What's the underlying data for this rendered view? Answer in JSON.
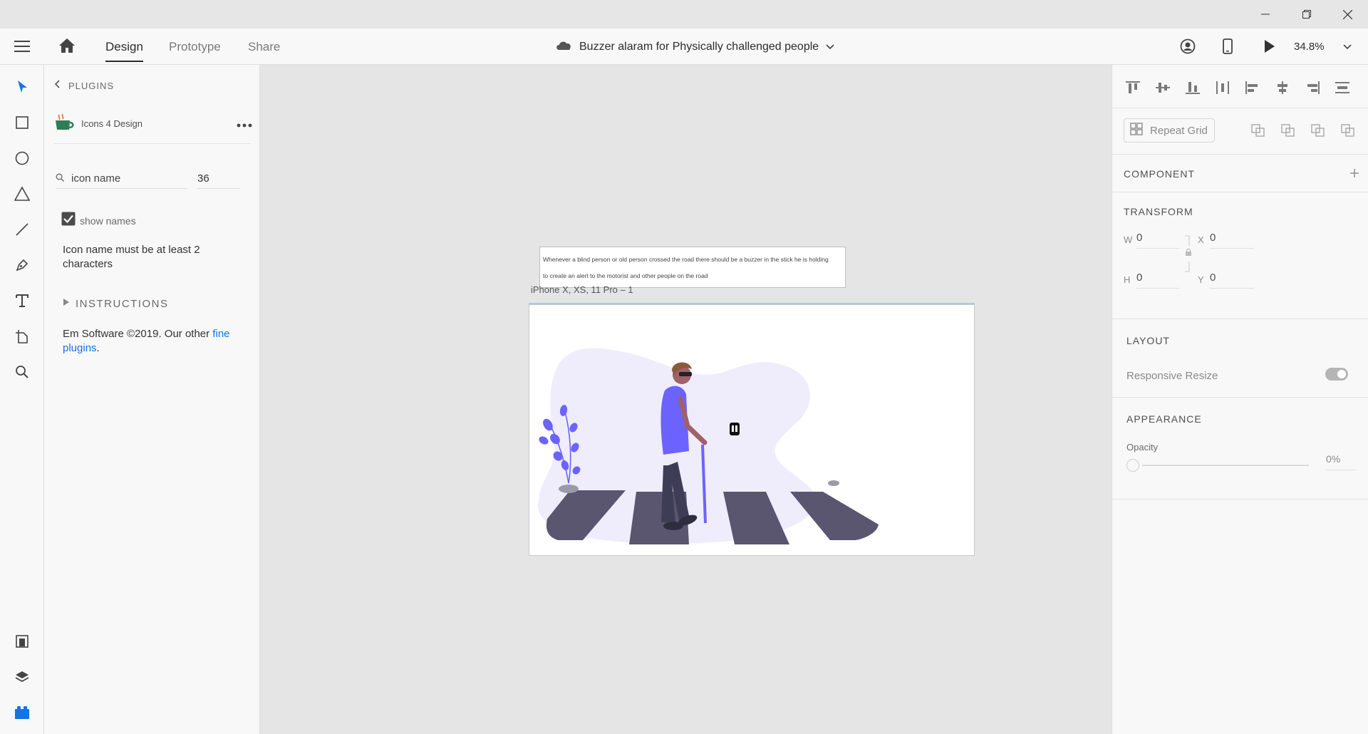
{
  "window": {
    "controls": [
      "minimize-icon",
      "restore-icon",
      "close-icon"
    ]
  },
  "toolbar": {
    "tabs": [
      {
        "label": "Design",
        "active": true
      },
      {
        "label": "Prototype",
        "active": false
      },
      {
        "label": "Share",
        "active": false
      }
    ],
    "document_title": "Buzzer alaram for Physically challenged people",
    "zoom": "34.8%"
  },
  "left_rail": {
    "tools": [
      "select-icon",
      "rectangle-icon",
      "ellipse-icon",
      "polygon-icon",
      "line-icon",
      "pen-icon",
      "text-icon",
      "artboard-icon",
      "zoom-icon"
    ],
    "bottom": [
      "assets-icon",
      "layers-icon",
      "plugins-icon"
    ]
  },
  "plugins": {
    "back_label": "PLUGINS",
    "plugin_name": "Icons 4 Design",
    "search_placeholder": "icon name",
    "size_value": "36",
    "show_names_label": "show names",
    "show_names_checked": true,
    "message": "Icon name must be at least 2 characters",
    "instructions_label": "INSTRUCTIONS",
    "footer_text": "Em Software ©2019. Our other ",
    "footer_link": "fine plugins",
    "footer_end": "."
  },
  "canvas": {
    "note_line1": "Whenever a blind person or old person crossed the road there should be a buzzer in the stick he is holding",
    "note_line2": "to create an alert to the motorist and other people on the road",
    "artboard_label": "iPhone X, XS, 11 Pro – 1"
  },
  "right_panel": {
    "repeat_grid_label": "Repeat Grid",
    "component_title": "COMPONENT",
    "transform_title": "TRANSFORM",
    "w_label": "W",
    "w_value": "0",
    "h_label": "H",
    "h_value": "0",
    "x_label": "X",
    "x_value": "0",
    "y_label": "Y",
    "y_value": "0",
    "layout_title": "LAYOUT",
    "responsive_label": "Responsive Resize",
    "appearance_title": "APPEARANCE",
    "opacity_label": "Opacity",
    "opacity_value": "0%"
  },
  "colors": {
    "accent": "#1473e6",
    "illustration_purple": "#6c63ff",
    "crosswalk": "#5a5670",
    "blob": "#efedfb"
  }
}
